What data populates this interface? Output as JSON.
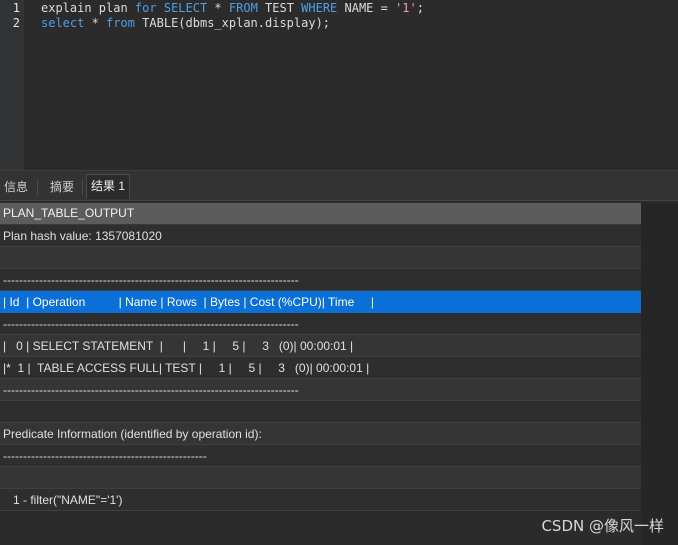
{
  "editor": {
    "lines": [
      {
        "number": "1",
        "tokens": [
          {
            "text": "explain plan ",
            "cls": ""
          },
          {
            "text": "for",
            "cls": "kw"
          },
          {
            "text": " ",
            "cls": ""
          },
          {
            "text": "SELECT",
            "cls": "kw"
          },
          {
            "text": " * ",
            "cls": ""
          },
          {
            "text": "FROM",
            "cls": "kw"
          },
          {
            "text": " TEST ",
            "cls": ""
          },
          {
            "text": "WHERE",
            "cls": "kw"
          },
          {
            "text": " NAME = ",
            "cls": ""
          },
          {
            "text": "'1'",
            "cls": "str"
          },
          {
            "text": ";",
            "cls": ""
          }
        ]
      },
      {
        "number": "2",
        "tokens": [
          {
            "text": "select",
            "cls": "kw"
          },
          {
            "text": " * ",
            "cls": ""
          },
          {
            "text": "from",
            "cls": "kw"
          },
          {
            "text": " TABLE(dbms_xplan.display);",
            "cls": ""
          }
        ]
      }
    ]
  },
  "tabs": [
    {
      "label": "信息",
      "active": false
    },
    {
      "label": "摘要",
      "active": false
    },
    {
      "label": "结果 1",
      "active": true
    }
  ],
  "result": {
    "column_header": "PLAN_TABLE_OUTPUT",
    "rows": [
      "Plan hash value: 1357081020",
      "",
      "--------------------------------------------------------------------------",
      "| Id  | Operation          | Name | Rows  | Bytes | Cost (%CPU)| Time     |",
      "--------------------------------------------------------------------------",
      "|   0 | SELECT STATEMENT  |      |     1 |     5 |     3   (0)| 00:00:01 |",
      "|*  1 |  TABLE ACCESS FULL| TEST |     1 |     5 |     3   (0)| 00:00:01 |",
      "--------------------------------------------------------------------------",
      "",
      "Predicate Information (identified by operation id):",
      "---------------------------------------------------",
      "",
      "   1 - filter(\"NAME\"='1')"
    ],
    "selected_row_index": 3
  },
  "watermark": "CSDN @像风一样"
}
